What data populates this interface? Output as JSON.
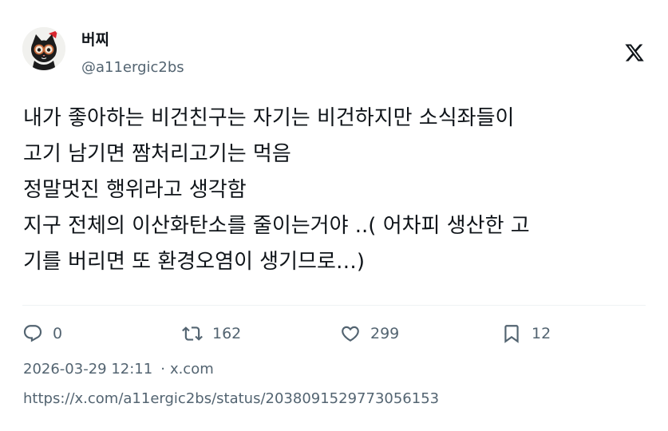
{
  "author": {
    "display_name": "버찌",
    "handle": "@a11ergic2bs"
  },
  "platform": {
    "logo_icon": "x-logo-icon"
  },
  "tweet": {
    "text": "내가 좋아하는 비건친구는 자기는 비건하지만 소식좌들이\n고기 남기면 짬처리고기는 먹음\n정말멋진 행위라고 생각함\n지구 전체의 이산화탄소를 줄이는거야 ..( 어차피 생산한 고\n기를 버리면 또 환경오염이 생기므로…)"
  },
  "actions": {
    "reply": {
      "icon": "reply-icon",
      "count": "0"
    },
    "retweet": {
      "icon": "retweet-icon",
      "count": "162"
    },
    "like": {
      "icon": "heart-icon",
      "count": "299"
    },
    "bookmark": {
      "icon": "bookmark-icon",
      "count": "12"
    }
  },
  "meta": {
    "timestamp": "2026-03-29 12:11",
    "separator": "·",
    "source": "x.com"
  },
  "status_url": "https://x.com/a11ergic2bs/status/2038091529773056153",
  "colors": {
    "text_primary": "#0f1419",
    "text_secondary": "#536471",
    "divider": "#eff3f4"
  }
}
